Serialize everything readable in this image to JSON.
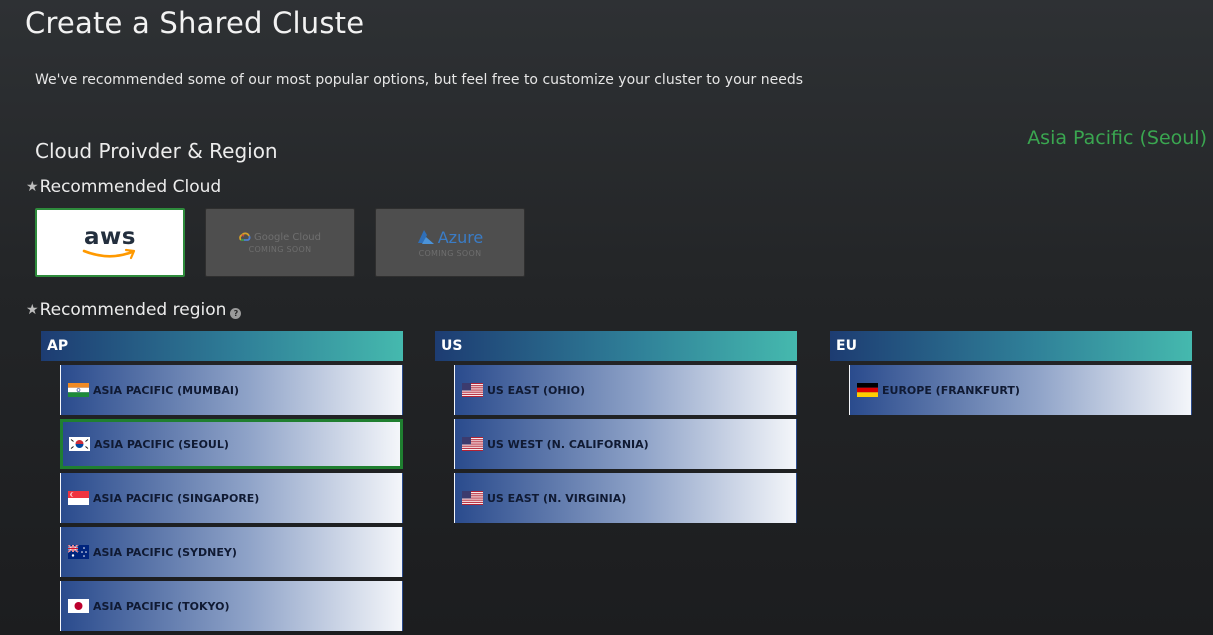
{
  "page": {
    "title": "Create a Shared Cluste",
    "subtitle": "We've recommended some of our most popular options, but feel free to customize your cluster to your needs",
    "selected_region_display": "Asia Pacific (Seoul)"
  },
  "cloud_section": {
    "title": "Cloud Proivder & Region",
    "recommended_cloud_label": "Recommended Cloud",
    "recommended_region_label": "Recommended region",
    "star_glyph": "★",
    "help_glyph": "?"
  },
  "providers": [
    {
      "name": "aws",
      "label": "aws",
      "selected": true,
      "disabled": false
    },
    {
      "name": "google-cloud",
      "label": "Google Cloud",
      "badge": "COMING SOON",
      "selected": false,
      "disabled": true
    },
    {
      "name": "azure",
      "label": "Azure",
      "badge": "COMING SOON",
      "selected": false,
      "disabled": true
    }
  ],
  "regions": {
    "ap": {
      "header": "AP",
      "items": [
        {
          "label": "ASIA PACIFIC (MUMBAI)",
          "flag": "india-flag-icon",
          "selected": false
        },
        {
          "label": "ASIA PACIFIC (SEOUL)",
          "flag": "south-korea-flag-icon",
          "selected": true
        },
        {
          "label": "ASIA PACIFIC (SINGAPORE)",
          "flag": "singapore-flag-icon",
          "selected": false
        },
        {
          "label": "ASIA PACIFIC (SYDNEY)",
          "flag": "australia-flag-icon",
          "selected": false
        },
        {
          "label": "ASIA PACIFIC (TOKYO)",
          "flag": "japan-flag-icon",
          "selected": false
        }
      ]
    },
    "us": {
      "header": "US",
      "items": [
        {
          "label": "US EAST (OHIO)",
          "flag": "us-flag-icon",
          "selected": false
        },
        {
          "label": "US WEST (N. CALIFORNIA)",
          "flag": "us-flag-icon",
          "selected": false
        },
        {
          "label": "US EAST (N. VIRGINIA)",
          "flag": "us-flag-icon",
          "selected": false
        }
      ]
    },
    "eu": {
      "header": "EU",
      "items": [
        {
          "label": "EUROPE (FRANKFURT)",
          "flag": "germany-flag-icon",
          "selected": false
        }
      ]
    }
  },
  "colors": {
    "selected_border": "#2e8b3c",
    "selected_region_text": "#3aa650",
    "header_gradient_start": "#1d3c72",
    "header_gradient_end": "#45b9ae"
  }
}
